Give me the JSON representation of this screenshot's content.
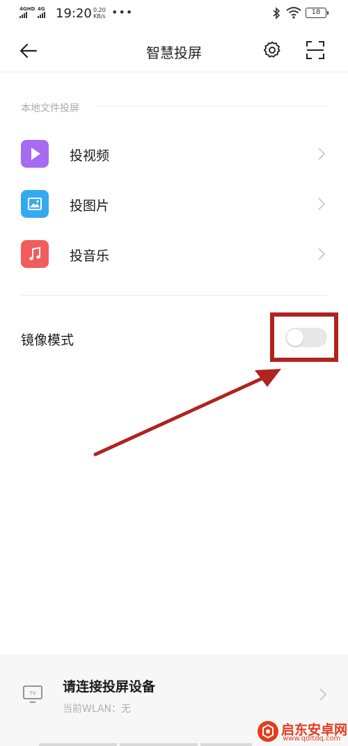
{
  "status_bar": {
    "signal1_label": "4GHD",
    "signal2_label": "4G",
    "time": "19:20",
    "speed_value": "0.20",
    "speed_unit": "KB/s",
    "more": "•••",
    "battery": "18"
  },
  "header": {
    "title": "智慧投屏",
    "back_icon": "arrow-left-icon",
    "settings_icon": "gear-icon",
    "scan_icon": "scan-icon"
  },
  "local_section": {
    "label": "本地文件投屏",
    "items": [
      {
        "label": "投视频",
        "icon": "video-play-icon",
        "color": "#a56bf0"
      },
      {
        "label": "投图片",
        "icon": "image-icon",
        "color": "#33aaf0"
      },
      {
        "label": "投音乐",
        "icon": "music-note-icon",
        "color": "#f25c5c"
      }
    ]
  },
  "mirror": {
    "label": "镜像模式",
    "enabled": false
  },
  "device": {
    "title": "请连接投屏设备",
    "wlan_status": "当前WLAN：无",
    "tv_icon_label": "TV"
  },
  "annotation": {
    "box_color": "#b0231f",
    "arrow_color": "#b0231f"
  },
  "watermark": {
    "text": "启东安卓网",
    "url": "www.qdltdq.com"
  }
}
